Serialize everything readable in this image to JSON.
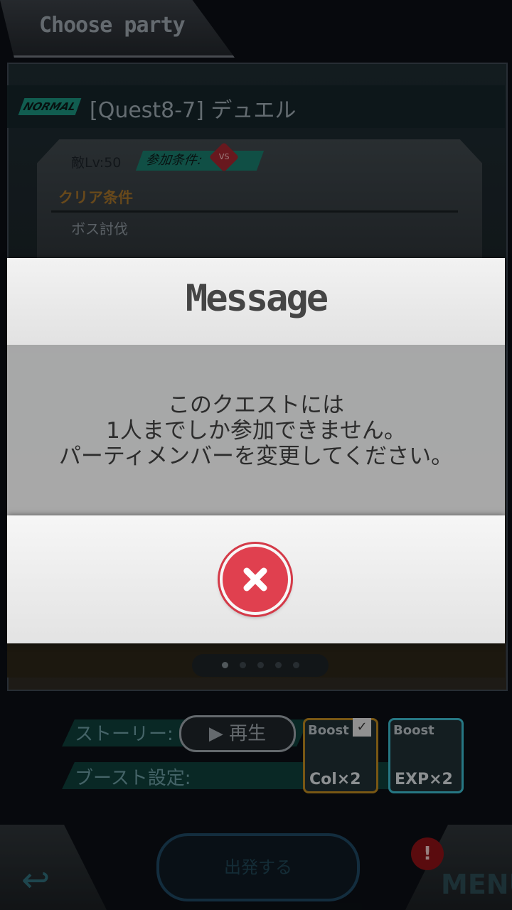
{
  "screen": {
    "title": "Choose party"
  },
  "quest": {
    "difficulty": "NORMAL",
    "name": "[Quest8-7] デュエル",
    "enemy_level": "敵Lv:50",
    "join_condition": "参加条件:",
    "vs_badge": "VS",
    "clear_condition_label": "クリア条件",
    "clear_condition_value": "ボス討伐"
  },
  "pager": {
    "pages": 5,
    "active_index": 0
  },
  "settings": {
    "story_label": "ストーリー:",
    "play_label": "▶ 再生",
    "boost_label": "ブースト設定:",
    "boosts": [
      {
        "title": "Boost",
        "name": "Col×2",
        "checked": true,
        "color": "#b8861f"
      },
      {
        "title": "Boost",
        "name": "EXP×2",
        "checked": false,
        "color": "#3bb7c9"
      }
    ]
  },
  "footer": {
    "depart_label": "出発する",
    "menu_label": "MENU",
    "alert_badge": "!"
  },
  "modal": {
    "title": "Message",
    "message_lines": [
      "このクエストには",
      "1人までしか参加できません。",
      "パーティメンバーを変更してください。"
    ],
    "close_color": "#e0404f"
  }
}
